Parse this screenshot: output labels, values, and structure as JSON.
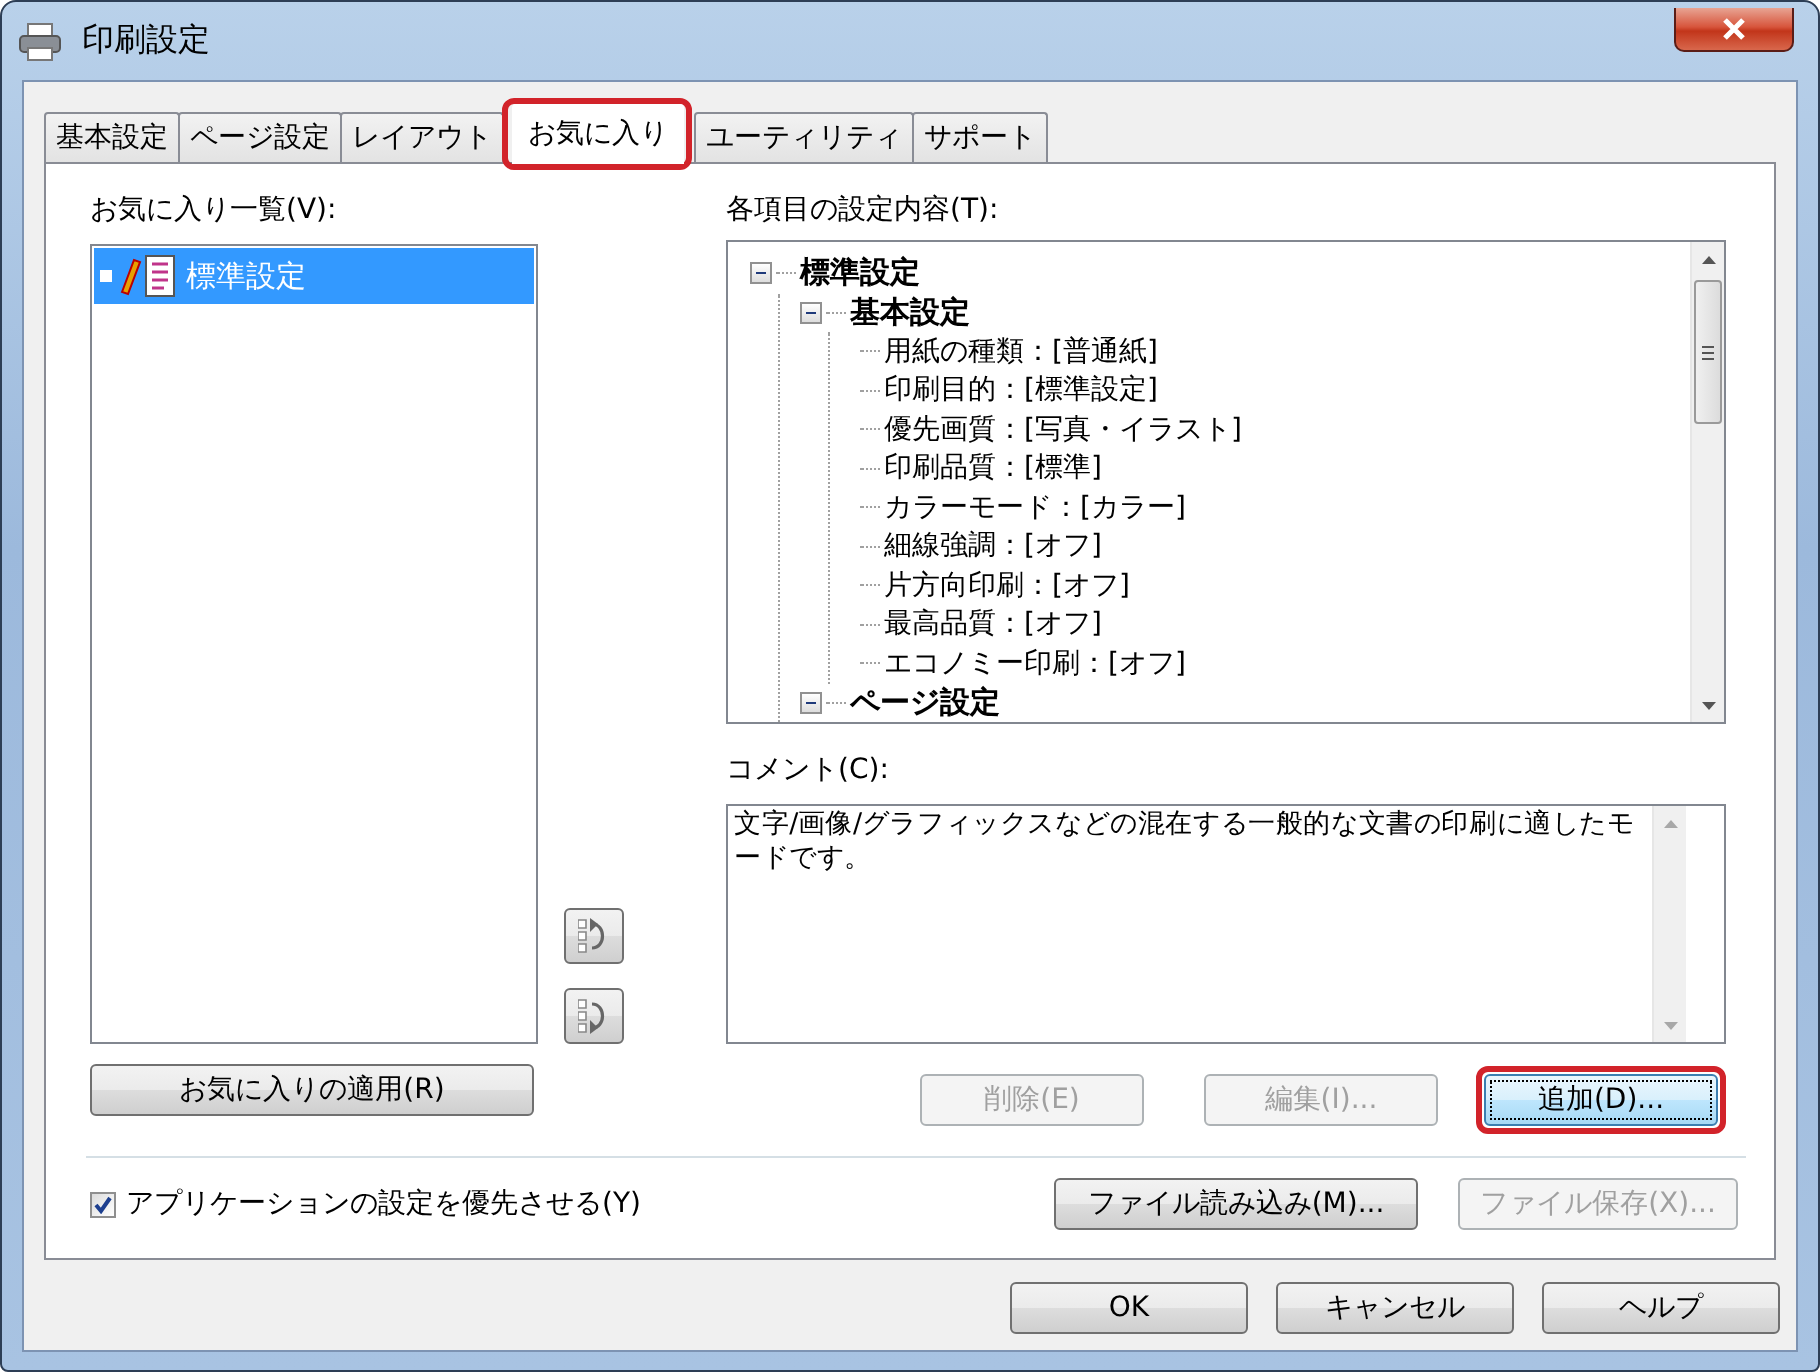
{
  "window": {
    "title": "印刷設定"
  },
  "tabs": [
    {
      "label": "基本設定",
      "selected": false,
      "highlighted": false
    },
    {
      "label": "ページ設定",
      "selected": false,
      "highlighted": false
    },
    {
      "label": "レイアウト",
      "selected": false,
      "highlighted": false
    },
    {
      "label": "お気に入り",
      "selected": true,
      "highlighted": true
    },
    {
      "label": "ユーティリティ",
      "selected": false,
      "highlighted": false
    },
    {
      "label": "サポート",
      "selected": false,
      "highlighted": false
    }
  ],
  "favorites": {
    "label": "お気に入り一覧(V):",
    "items": [
      {
        "label": "標準設定",
        "selected": true
      }
    ],
    "apply_button": {
      "label": "お気に入りの適用(R)",
      "disabled": false
    }
  },
  "settings": {
    "label": "各項目の設定内容(T):",
    "tree": [
      {
        "label": "標準設定",
        "kind": "group",
        "expanded": true,
        "children": [
          {
            "label": "基本設定",
            "kind": "group",
            "expanded": true,
            "children": [
              {
                "label": "用紙の種類：[普通紙]",
                "kind": "setting"
              },
              {
                "label": "印刷目的：[標準設定]",
                "kind": "setting"
              },
              {
                "label": "優先画質：[写真・イラスト]",
                "kind": "setting"
              },
              {
                "label": "印刷品質：[標準]",
                "kind": "setting"
              },
              {
                "label": "カラーモード：[カラー]",
                "kind": "setting"
              },
              {
                "label": "細線強調：[オフ]",
                "kind": "setting"
              },
              {
                "label": "片方向印刷：[オフ]",
                "kind": "setting"
              },
              {
                "label": "最高品質：[オフ]",
                "kind": "setting"
              },
              {
                "label": "エコノミー印刷：[オフ]",
                "kind": "setting"
              }
            ]
          },
          {
            "label": "ページ設定",
            "kind": "group",
            "expanded": true
          }
        ]
      }
    ]
  },
  "comment": {
    "label": "コメント(C):",
    "text": "文字/画像/グラフィックスなどの混在する一般的な文書の印刷に適したモードです。"
  },
  "action_buttons": [
    {
      "label": "削除(E)",
      "disabled": true,
      "highlighted": false
    },
    {
      "label": "編集(I)...",
      "disabled": true,
      "highlighted": false
    },
    {
      "label": "追加(D)...",
      "disabled": false,
      "highlighted": true
    }
  ],
  "priority_checkbox": {
    "label": "アプリケーションの設定を優先させる(Y)",
    "checked": true
  },
  "file_buttons": [
    {
      "label": "ファイル読み込み(M)...",
      "disabled": false
    },
    {
      "label": "ファイル保存(X)...",
      "disabled": true
    }
  ],
  "dialog_buttons": [
    {
      "label": "OK"
    },
    {
      "label": "キャンセル"
    },
    {
      "label": "ヘルプ"
    }
  ]
}
